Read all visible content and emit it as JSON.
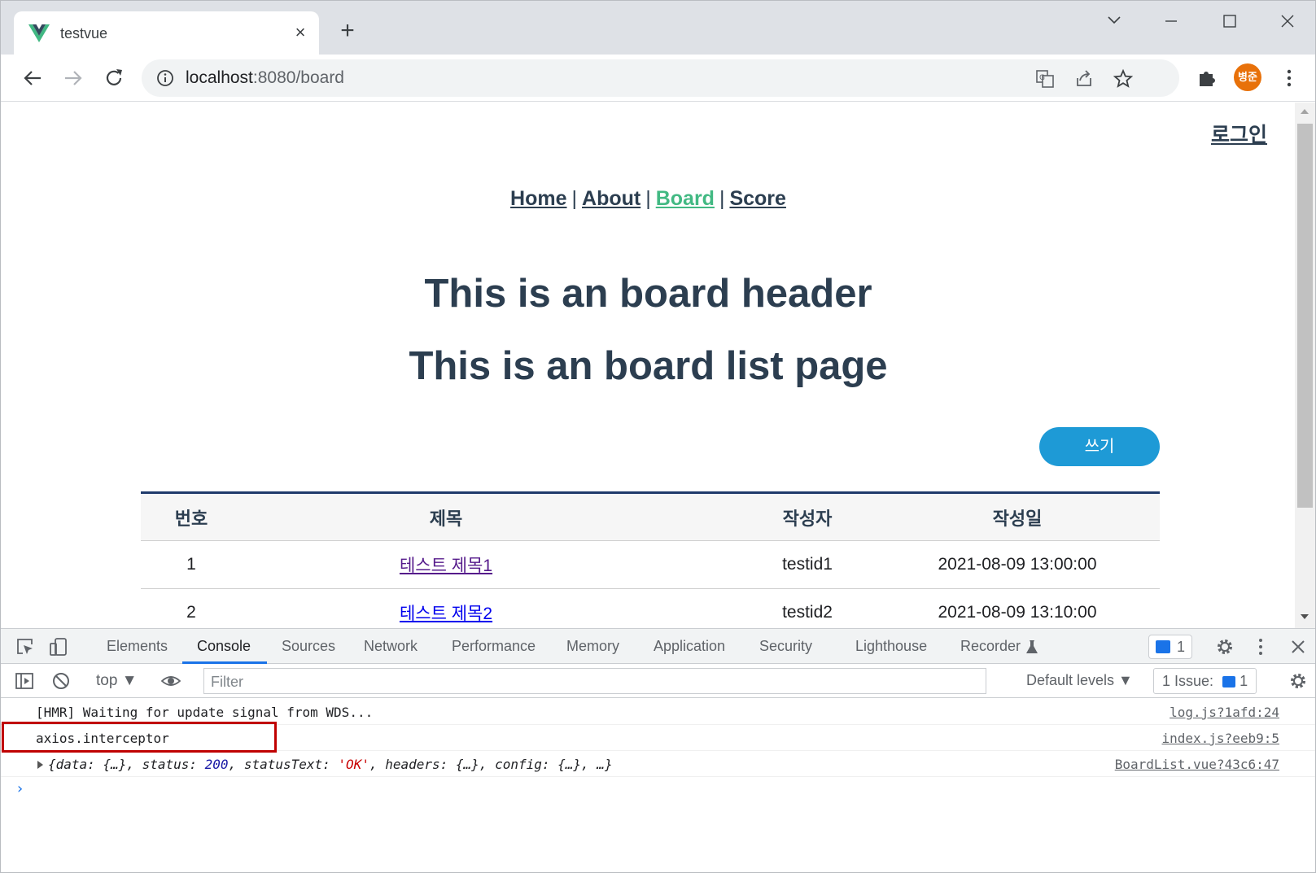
{
  "browser": {
    "tab_title": "testvue",
    "tab_close": "×",
    "new_tab": "+",
    "url_host": "localhost",
    "url_port_path": ":8080/board",
    "avatar_text": "병준"
  },
  "page": {
    "login_link": "로그인",
    "nav": {
      "home": "Home",
      "about": "About",
      "board": "Board",
      "score": "Score",
      "separator": "|"
    },
    "header_title": "This is an board header",
    "list_title": "This is an board list page",
    "write_button": "쓰기",
    "table": {
      "headers": [
        "번호",
        "제목",
        "작성자",
        "작성일"
      ],
      "rows": [
        {
          "no": "1",
          "title": "테스트 제목1",
          "author": "testid1",
          "date": "2021-08-09 13:00:00"
        },
        {
          "no": "2",
          "title": "테스트 제목2",
          "author": "testid2",
          "date": "2021-08-09 13:10:00"
        }
      ]
    }
  },
  "devtools": {
    "tabs": [
      "Elements",
      "Console",
      "Sources",
      "Network",
      "Performance",
      "Memory",
      "Application",
      "Security",
      "Lighthouse",
      "Recorder"
    ],
    "active_tab": "Console",
    "messages_badge": "1",
    "context": "top ▼",
    "filter_placeholder": "Filter",
    "levels": "Default levels ▼",
    "issues": "1 Issue:",
    "issues_count": "1",
    "console_lines": [
      {
        "text": "[HMR] Waiting for update signal from WDS...",
        "source": "log.js?1afd:24"
      },
      {
        "text": "axios.interceptor",
        "source": "index.js?eeb9:5"
      },
      {
        "source": "BoardList.vue?43c6:47"
      }
    ],
    "object_line": {
      "p1": "{data: {…}, status: ",
      "status": "200",
      "p2": ", statusText: ",
      "status_text": "'OK'",
      "p3": ", headers: {…}, config: {…}, …}"
    },
    "prompt": "›"
  },
  "colors": {
    "accent": "#1a73e8",
    "vue_green": "#42b983",
    "vue_text": "#2c3e50",
    "write_button": "#1e9ad6",
    "highlight_box": "#c00000"
  }
}
